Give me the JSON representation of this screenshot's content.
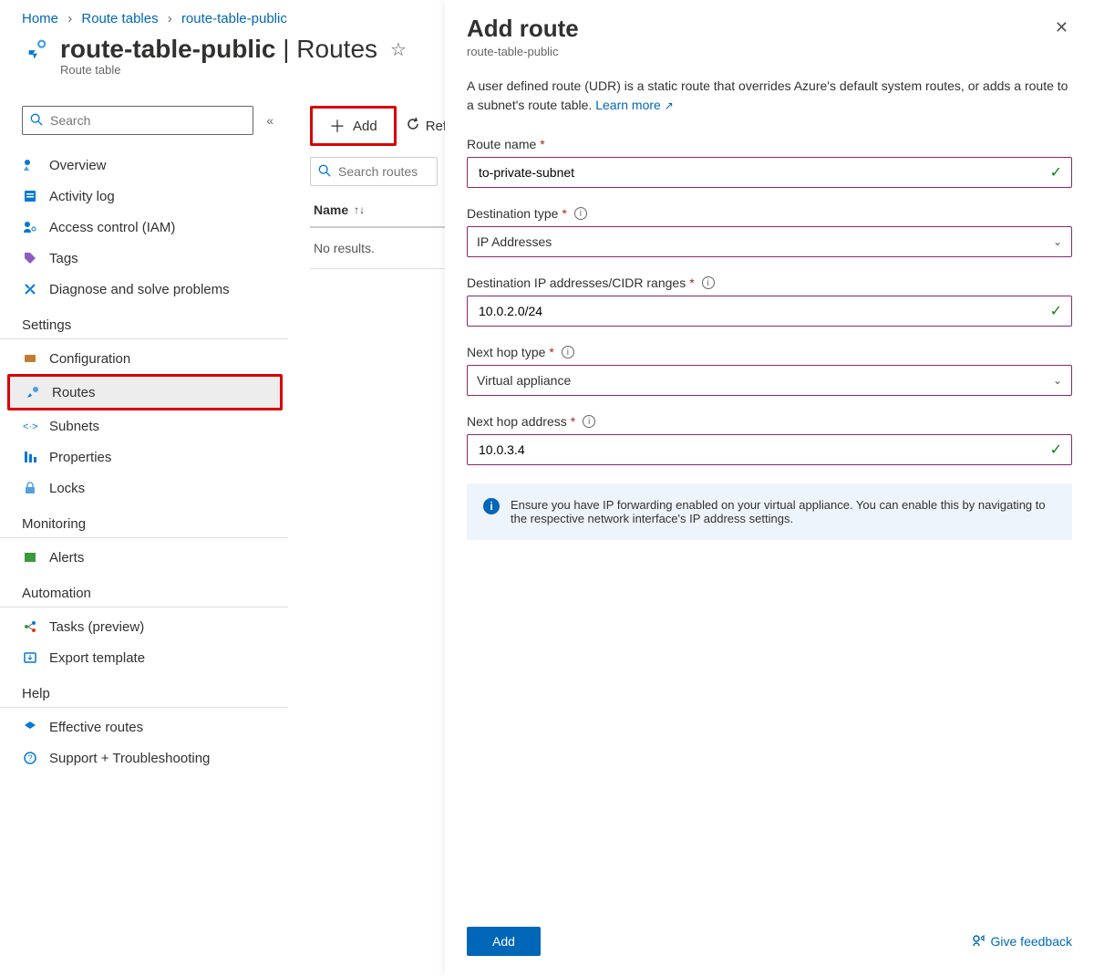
{
  "breadcrumb": {
    "home": "Home",
    "route_tables": "Route tables",
    "current": "route-table-public"
  },
  "header": {
    "title": "route-table-public",
    "section": "Routes",
    "subtitle": "Route table"
  },
  "sidebar": {
    "search_placeholder": "Search",
    "items_top": [
      {
        "label": "Overview"
      },
      {
        "label": "Activity log"
      },
      {
        "label": "Access control (IAM)"
      },
      {
        "label": "Tags"
      },
      {
        "label": "Diagnose and solve problems"
      }
    ],
    "settings_label": "Settings",
    "items_settings": [
      {
        "label": "Configuration"
      },
      {
        "label": "Routes",
        "active": true
      },
      {
        "label": "Subnets"
      },
      {
        "label": "Properties"
      },
      {
        "label": "Locks"
      }
    ],
    "monitoring_label": "Monitoring",
    "items_monitoring": [
      {
        "label": "Alerts"
      }
    ],
    "automation_label": "Automation",
    "items_automation": [
      {
        "label": "Tasks (preview)"
      },
      {
        "label": "Export template"
      }
    ],
    "help_label": "Help",
    "items_help": [
      {
        "label": "Effective routes"
      },
      {
        "label": "Support + Troubleshooting"
      }
    ]
  },
  "toolbar": {
    "add_label": "Add",
    "refresh_label": "Ref"
  },
  "routes": {
    "search_placeholder": "Search routes",
    "col_name": "Name",
    "no_results": "No results."
  },
  "panel": {
    "title": "Add route",
    "subtitle": "route-table-public",
    "description": "A user defined route (UDR) is a static route that overrides Azure's default system routes, or adds a route to a subnet's route table.",
    "learn_more": "Learn more",
    "fields": {
      "route_name": {
        "label": "Route name",
        "value": "to-private-subnet"
      },
      "destination_type": {
        "label": "Destination type",
        "value": "IP Addresses"
      },
      "destination_ip": {
        "label": "Destination IP addresses/CIDR ranges",
        "value": "10.0.2.0/24"
      },
      "next_hop_type": {
        "label": "Next hop type",
        "value": "Virtual appliance"
      },
      "next_hop_address": {
        "label": "Next hop address",
        "value": "10.0.3.4"
      }
    },
    "info_text": "Ensure you have IP forwarding enabled on your virtual appliance. You can enable this by navigating to the respective network interface's IP address settings.",
    "add_button": "Add",
    "feedback": "Give feedback"
  }
}
